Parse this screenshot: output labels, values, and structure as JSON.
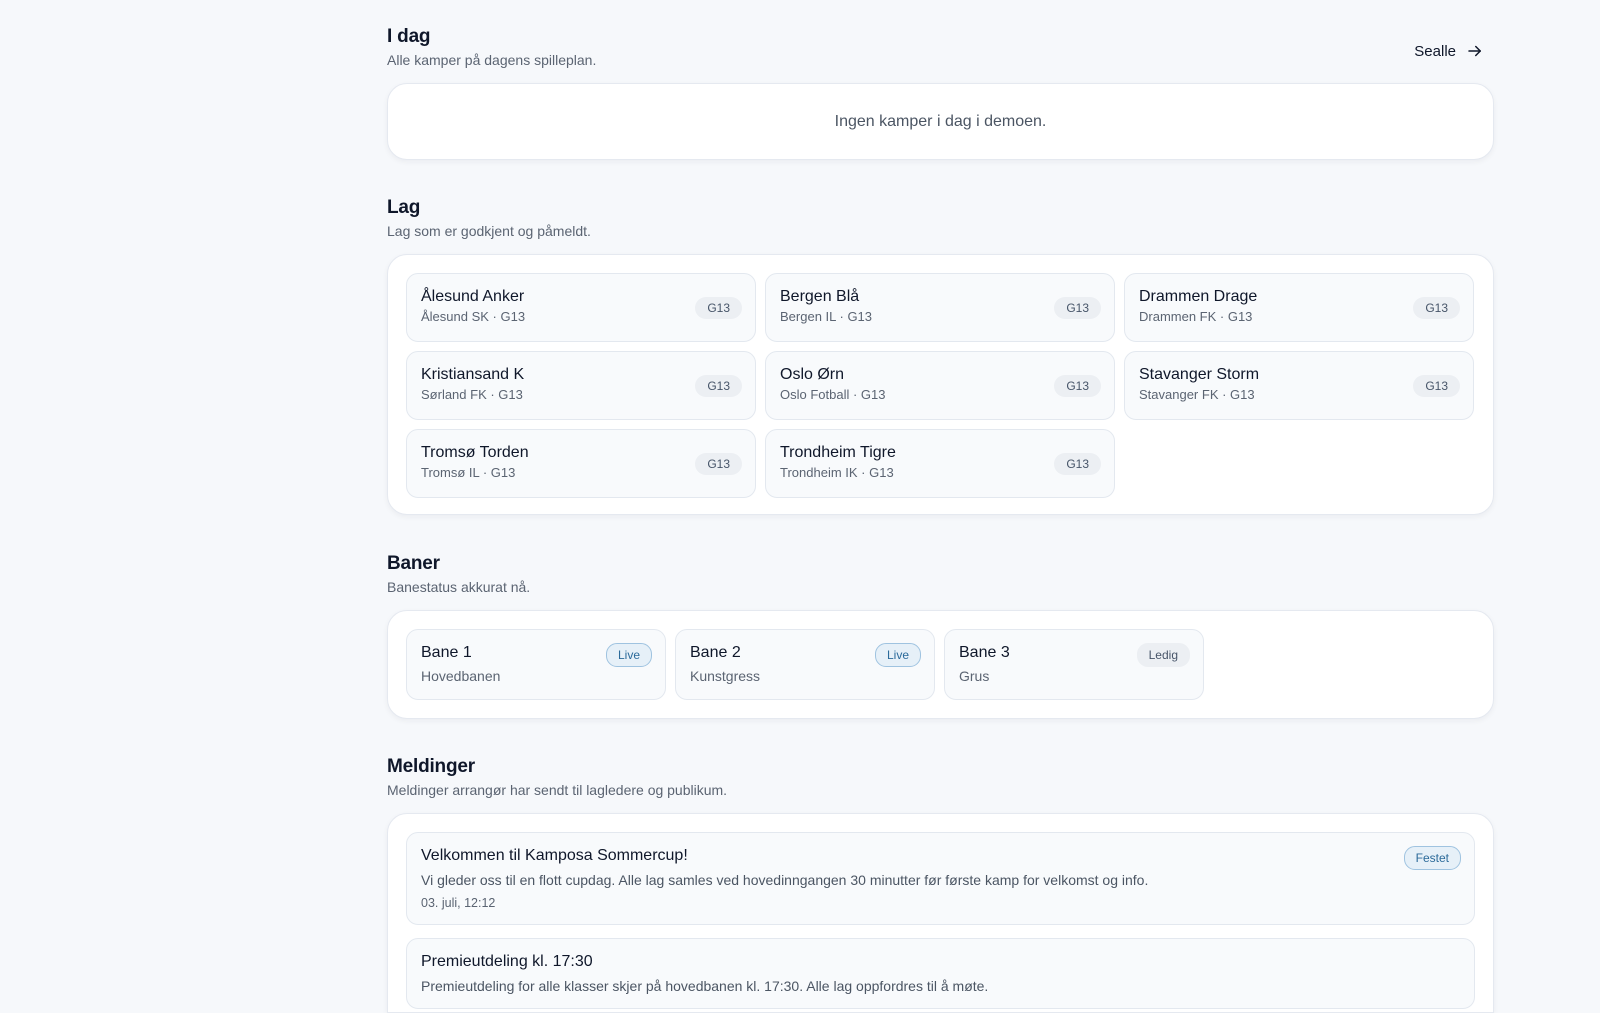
{
  "today": {
    "title": "I dag",
    "subtitle": "Alle kamper på dagens spilleplan.",
    "see_all": "Sealle",
    "empty_text": "Ingen kamper i dag i demoen."
  },
  "teams": {
    "title": "Lag",
    "subtitle": "Lag som er godkjent og påmeldt.",
    "items": [
      {
        "name": "Ålesund Anker",
        "sub": "Ålesund SK · G13",
        "tag": "G13"
      },
      {
        "name": "Bergen Blå",
        "sub": "Bergen IL · G13",
        "tag": "G13"
      },
      {
        "name": "Drammen Drage",
        "sub": "Drammen FK · G13",
        "tag": "G13"
      },
      {
        "name": "Kristiansand K",
        "sub": "Sørland FK · G13",
        "tag": "G13"
      },
      {
        "name": "Oslo Ørn",
        "sub": "Oslo Fotball · G13",
        "tag": "G13"
      },
      {
        "name": "Stavanger Storm",
        "sub": "Stavanger FK · G13",
        "tag": "G13"
      },
      {
        "name": "Tromsø Torden",
        "sub": "Tromsø IL · G13",
        "tag": "G13"
      },
      {
        "name": "Trondheim Tigre",
        "sub": "Trondheim IK · G13",
        "tag": "G13"
      }
    ]
  },
  "fields": {
    "title": "Baner",
    "subtitle": "Banestatus akkurat nå.",
    "items": [
      {
        "name": "Bane 1",
        "sub": "Hovedbanen",
        "status": "Live"
      },
      {
        "name": "Bane 2",
        "sub": "Kunstgress",
        "status": "Live"
      },
      {
        "name": "Bane 3",
        "sub": "Grus",
        "status": "Ledig"
      }
    ]
  },
  "messages": {
    "title": "Meldinger",
    "subtitle": "Meldinger arrangør har sendt til lagledere og publikum.",
    "items": [
      {
        "title": "Velkommen til Kamposa Sommercup!",
        "body": "Vi gleder oss til en flott cupdag. Alle lag samles ved hovedinngangen 30 minutter før første kamp for velkomst og info.",
        "time": "03. juli, 12:12",
        "badge": "Festet"
      },
      {
        "title": "Premieutdeling kl. 17:30",
        "body": "Premieutdeling for alle klasser skjer på hovedbanen kl. 17:30. Alle lag oppfordres til å møte.",
        "time": "",
        "badge": ""
      }
    ]
  },
  "colors": {
    "background": "#f6f8fb",
    "accent_live": "#2b6a9a",
    "text_primary": "#0f172a",
    "text_muted": "#5b6472"
  }
}
